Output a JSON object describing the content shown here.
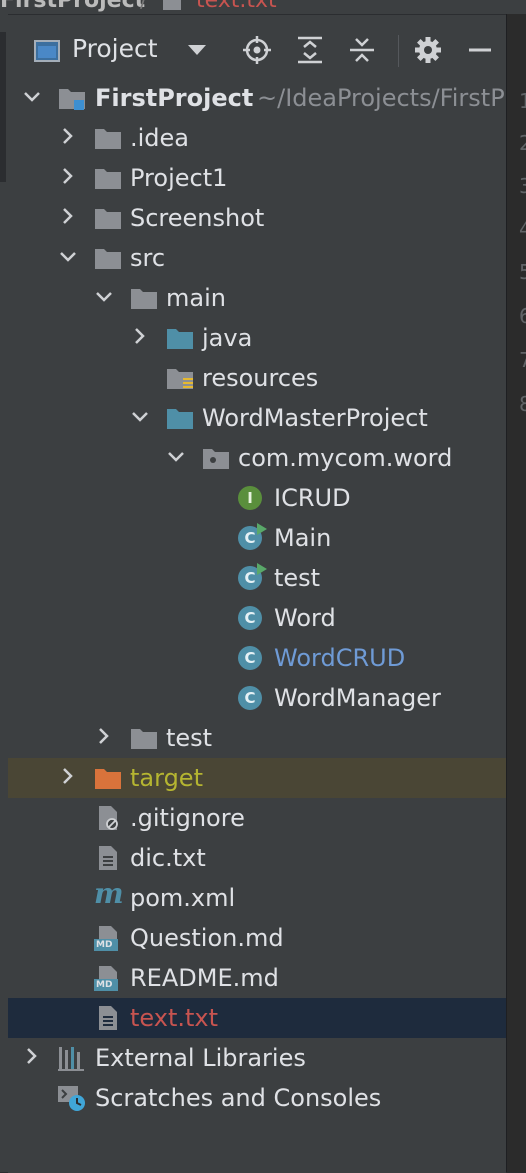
{
  "breadcrumb": {
    "project": "FirstProject",
    "separator": "/",
    "file": "text.txt"
  },
  "panel": {
    "title": "Project"
  },
  "tree": {
    "root": {
      "name": "FirstProject",
      "path": "~/IdeaProjects/FirstP"
    },
    "idea": ".idea",
    "project1": "Project1",
    "screenshot": "Screenshot",
    "src": "src",
    "main": "main",
    "java": "java",
    "resources": "resources",
    "wordmaster": "WordMasterProject",
    "package": "com.mycom.word",
    "icrud": "ICRUD",
    "main_class": "Main",
    "test_class": "test",
    "word": "Word",
    "wordcrud": "WordCRUD",
    "wordmanager": "WordManager",
    "test_folder": "test",
    "target": "target",
    "gitignore": ".gitignore",
    "dic": "dic.txt",
    "pom": "pom.xml",
    "question": "Question.md",
    "readme": "README.md",
    "text": "text.txt",
    "external": "External Libraries",
    "scratches": "Scratches and Consoles"
  },
  "icon_badges": {
    "class": "C",
    "interface": "I",
    "markdown": "MD",
    "maven": "m"
  },
  "line_numbers": [
    "1",
    "2",
    "3",
    "4",
    "5",
    "6",
    "7",
    "8"
  ],
  "colors": {
    "panel_bg": "#3c3f41",
    "text": "#dfe1e5",
    "target_text": "#b5b531",
    "target_row": "#4a4635",
    "selected_row": "#1e2b3d",
    "modified_text": "#6f9bd6",
    "untracked_text": "#c75450",
    "class_icon": "#4f8fa7",
    "interface_icon": "#5a8f3c"
  }
}
